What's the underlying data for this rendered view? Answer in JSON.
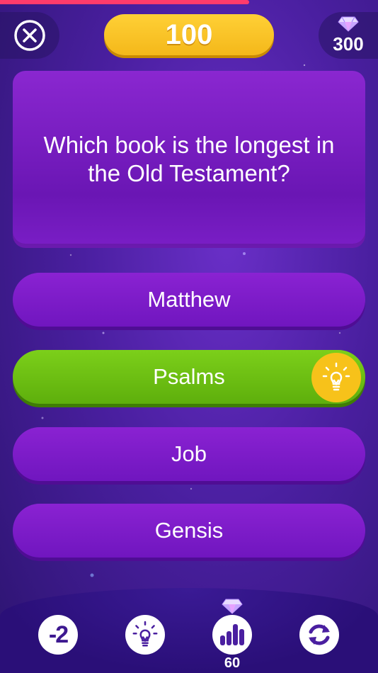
{
  "timer": {
    "progress": 0.66
  },
  "header": {
    "close_icon": "close-icon",
    "score": "100",
    "gems_icon": "diamond-icon",
    "gems": "300"
  },
  "question": {
    "text": "Which book is the longest in the Old Testament?"
  },
  "answers": [
    {
      "label": "Matthew",
      "state": "default"
    },
    {
      "label": "Psalms",
      "state": "correct",
      "hint_icon": "lightbulb-icon"
    },
    {
      "label": "Job",
      "state": "default"
    },
    {
      "label": "Gensis",
      "state": "default"
    }
  ],
  "powerups": {
    "fifty_fifty": {
      "label": "-2"
    },
    "hint": {
      "icon": "lightbulb-icon"
    },
    "audience_poll": {
      "icon": "bar-chart-icon",
      "cost_icon": "diamond-icon",
      "cost": "60"
    },
    "swap": {
      "icon": "refresh-icon"
    }
  },
  "colors": {
    "accent_yellow": "#f7c21a",
    "correct_green": "#6cbf12",
    "answer_purple": "#7e1cc8",
    "timer_red": "#ff3b6b"
  }
}
